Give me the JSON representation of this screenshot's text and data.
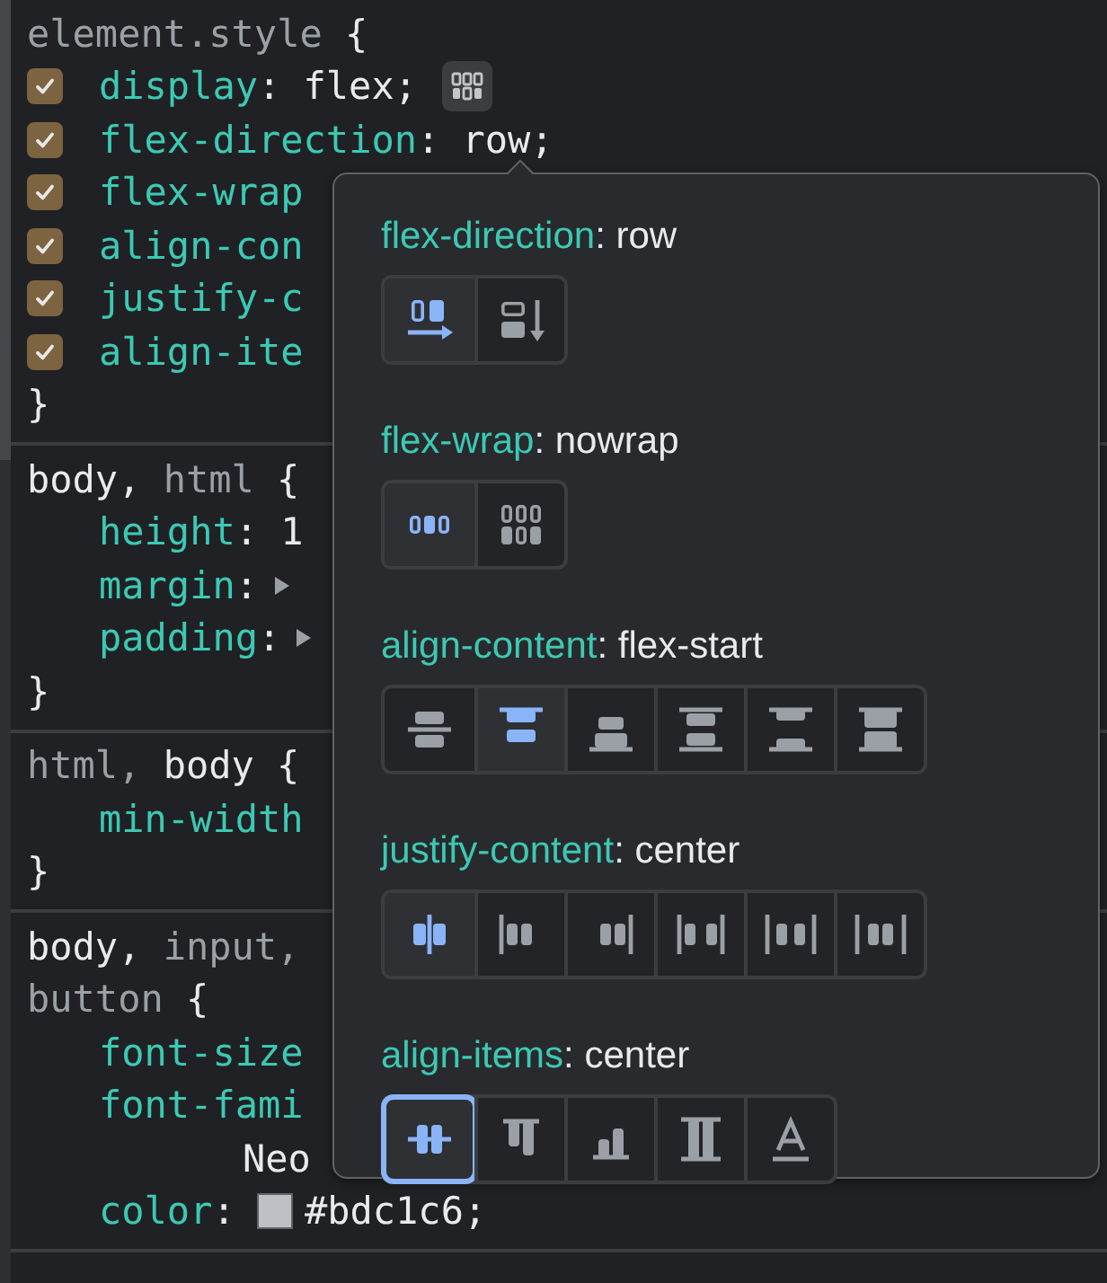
{
  "rules": [
    {
      "selector_lines": [
        [
          {
            "text": "element.style",
            "kind": "unmatched"
          },
          {
            "text": "{",
            "kind": "brace"
          }
        ]
      ],
      "declarations": [
        {
          "kind": "checkbox",
          "checked": true,
          "name": "display",
          "colon": ":",
          "value": "flex;",
          "flex_editor": true
        },
        {
          "kind": "checkbox",
          "checked": true,
          "name": "flex-direction",
          "colon": ":",
          "value": "row;"
        },
        {
          "kind": "checkbox",
          "checked": true,
          "name": "flex-wrap"
        },
        {
          "kind": "checkbox",
          "checked": true,
          "name": "align-con"
        },
        {
          "kind": "checkbox",
          "checked": true,
          "name": "justify-c"
        },
        {
          "kind": "checkbox",
          "checked": true,
          "name": "align-ite"
        }
      ],
      "close": "}"
    },
    {
      "selector_lines": [
        [
          {
            "text": "body,",
            "kind": "matched"
          },
          {
            "text": "html",
            "kind": "unmatched"
          },
          {
            "text": "{",
            "kind": "brace"
          }
        ]
      ],
      "declarations": [
        {
          "kind": "plain",
          "name": "height",
          "colon": ":",
          "value": "1"
        },
        {
          "kind": "plain",
          "name": "margin",
          "colon": ":",
          "expander": true,
          "expanded": false
        },
        {
          "kind": "plain",
          "name": "padding",
          "colon": ":",
          "expander": true,
          "expanded": false
        }
      ],
      "close": "}"
    },
    {
      "selector_lines": [
        [
          {
            "text": "html,",
            "kind": "unmatched"
          },
          {
            "text": "body",
            "kind": "matched"
          },
          {
            "text": "{",
            "kind": "brace"
          }
        ]
      ],
      "declarations": [
        {
          "kind": "plain",
          "name": "min-width"
        }
      ],
      "close": "}"
    },
    {
      "selector_lines": [
        [
          {
            "text": "body,",
            "kind": "matched"
          },
          {
            "text": "input,",
            "kind": "unmatched"
          }
        ],
        [
          {
            "text": "button",
            "kind": "unmatched"
          },
          {
            "text": "{",
            "kind": "brace"
          }
        ]
      ],
      "declarations": [
        {
          "kind": "plain",
          "name": "font-size"
        },
        {
          "kind": "plain",
          "name": "font-fami"
        },
        {
          "kind": "continuation",
          "value": "Neo"
        },
        {
          "kind": "plain",
          "name": "color",
          "colon": ":",
          "color": "#bdc1c6",
          "value": "#bdc1c6;"
        }
      ]
    }
  ],
  "flex_editor": {
    "sections": [
      {
        "property": "flex-direction",
        "colon": ":",
        "value": "row",
        "options": [
          {
            "kind": "row",
            "selected": true
          },
          {
            "kind": "column",
            "selected": false
          }
        ]
      },
      {
        "property": "flex-wrap",
        "colon": ":",
        "value": "nowrap",
        "options": [
          {
            "kind": "nowrap",
            "selected": true
          },
          {
            "kind": "wrap",
            "selected": false
          }
        ]
      },
      {
        "property": "align-content",
        "colon": ":",
        "value": "flex-start",
        "options": [
          {
            "kind": "ac-center",
            "selected": false
          },
          {
            "kind": "ac-start",
            "selected": true
          },
          {
            "kind": "ac-end",
            "selected": false
          },
          {
            "kind": "ac-around",
            "selected": false
          },
          {
            "kind": "ac-between",
            "selected": false
          },
          {
            "kind": "ac-stretch",
            "selected": false
          }
        ]
      },
      {
        "property": "justify-content",
        "colon": ":",
        "value": "center",
        "options": [
          {
            "kind": "jc-center",
            "selected": true
          },
          {
            "kind": "jc-start",
            "selected": false
          },
          {
            "kind": "jc-end",
            "selected": false
          },
          {
            "kind": "jc-between",
            "selected": false
          },
          {
            "kind": "jc-around",
            "selected": false
          },
          {
            "kind": "jc-evenly",
            "selected": false
          }
        ]
      },
      {
        "property": "align-items",
        "colon": ":",
        "value": "center",
        "options": [
          {
            "kind": "ai-center",
            "selected": true,
            "focused": true
          },
          {
            "kind": "ai-start",
            "selected": false,
            "focused": false
          },
          {
            "kind": "ai-end",
            "selected": false,
            "focused": false
          },
          {
            "kind": "ai-stretch",
            "selected": false,
            "focused": false
          },
          {
            "kind": "ai-baseline",
            "selected": false,
            "focused": false
          }
        ]
      }
    ]
  }
}
